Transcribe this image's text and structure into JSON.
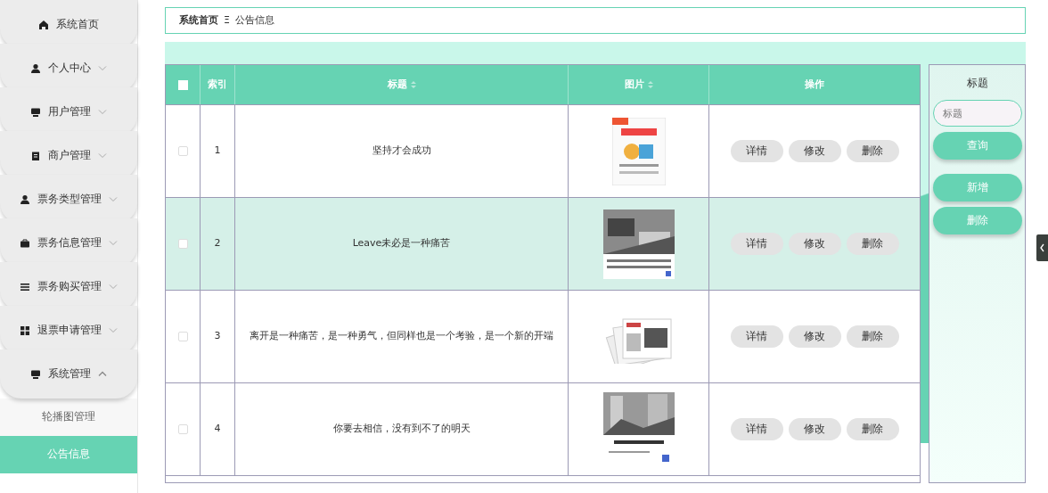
{
  "sidebar": {
    "items": [
      {
        "label": "系统首页"
      },
      {
        "label": "个人中心",
        "expanded": false
      },
      {
        "label": "用户管理",
        "expanded": false
      },
      {
        "label": "商户管理",
        "expanded": false
      },
      {
        "label": "票务类型管理",
        "expanded": false
      },
      {
        "label": "票务信息管理",
        "expanded": false
      },
      {
        "label": "票务购买管理",
        "expanded": false
      },
      {
        "label": "退票申请管理",
        "expanded": false
      },
      {
        "label": "系统管理",
        "expanded": true,
        "children": [
          {
            "label": "轮播图管理",
            "selected": false
          },
          {
            "label": "公告信息",
            "selected": true
          }
        ]
      }
    ]
  },
  "breadcrumb": {
    "items": [
      "系统首页",
      "公告信息"
    ],
    "separator": "Ξ"
  },
  "table": {
    "all_checked": false,
    "columns": [
      {
        "label": "索引",
        "sortable": false
      },
      {
        "label": "标题",
        "sortable": true
      },
      {
        "label": "图片",
        "sortable": true
      },
      {
        "label": "操作",
        "sortable": false
      }
    ],
    "rows": [
      {
        "index": "1",
        "title": "坚持才会成功",
        "highlighted": false,
        "checked": false,
        "actions": [
          "详情",
          "修改",
          "删除"
        ]
      },
      {
        "index": "2",
        "title": "Leave未必是一种痛苦",
        "highlighted": true,
        "checked": false,
        "actions": [
          "详情",
          "修改",
          "删除"
        ]
      },
      {
        "index": "3",
        "title": "离开是一种痛苦，是一种勇气，但同样也是一个考验，是一个新的开端",
        "highlighted": false,
        "checked": false,
        "actions": [
          "详情",
          "修改",
          "删除"
        ]
      },
      {
        "index": "4",
        "title": "你要去相信，没有到不了的明天",
        "highlighted": false,
        "checked": false,
        "actions": [
          "详情",
          "修改",
          "删除"
        ]
      }
    ]
  },
  "search_panel": {
    "label": "标题",
    "placeholder": "标题",
    "buttons": [
      "查询",
      "新增",
      "删除"
    ]
  }
}
